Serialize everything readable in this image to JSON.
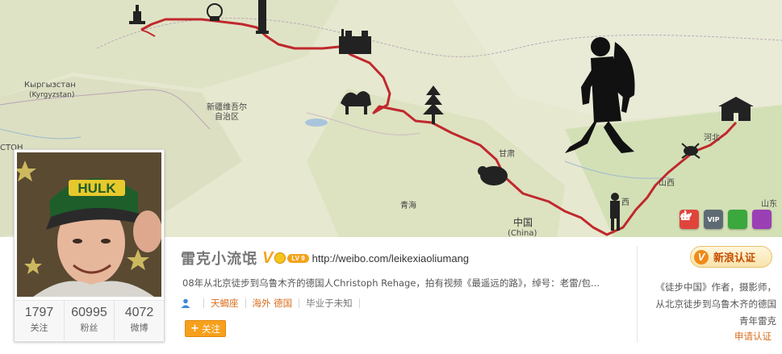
{
  "cover": {
    "labels": {
      "kyrgyzstan": "Кыргызстан",
      "kyrgyzstan_en": "(Kyrgyzstan)",
      "xinjiang": "新疆维吾尔\n自治区",
      "gansu": "甘肃",
      "qinghai": "青海",
      "china": "中国",
      "china_en": "(China)",
      "hebei": "河北",
      "shanxi": "山西",
      "shaanxi": "西",
      "shandong": "山东",
      "west_edge": "СТОН"
    },
    "icons": [
      {
        "name": "download-icon",
        "color": "#e0453c",
        "glyph": "↓"
      },
      {
        "name": "vip-icon",
        "color": "#5f6b74",
        "glyph": "VIP"
      },
      {
        "name": "link-icon",
        "color": "#3aa83c",
        "glyph": "∞"
      },
      {
        "name": "chart-icon",
        "color": "#9b3fb5",
        "glyph": "▮"
      }
    ]
  },
  "profile": {
    "name": "雷克小流氓",
    "verified_mark": "V",
    "level": "LV 9",
    "homepage": "http://weibo.com/leikexiaoliumang",
    "intro": "08年从北京徒步到乌鲁木齐的德国人Christoph Rehage，拍有视频《最遥远的路》，绰号：老雷/包...",
    "tags": {
      "constellation": "天蝎座",
      "location": "海外 德国",
      "school": "毕业于未知"
    },
    "follow_label": "关注",
    "follow_plus": "+"
  },
  "stats": [
    {
      "value": "1797",
      "label": "关注"
    },
    {
      "value": "60995",
      "label": "粉丝"
    },
    {
      "value": "4072",
      "label": "微博"
    }
  ],
  "verification": {
    "badge_label": "新浪认证",
    "badge_mark": "V",
    "description": "《徒步中国》作者，摄影师，从北京徒步到乌鲁木齐的德国青年雷克",
    "apply_label": "申请认证"
  },
  "colors": {
    "accent_orange": "#f7a01c",
    "link_orange": "#d86e1d",
    "route_red": "#c0282d"
  }
}
